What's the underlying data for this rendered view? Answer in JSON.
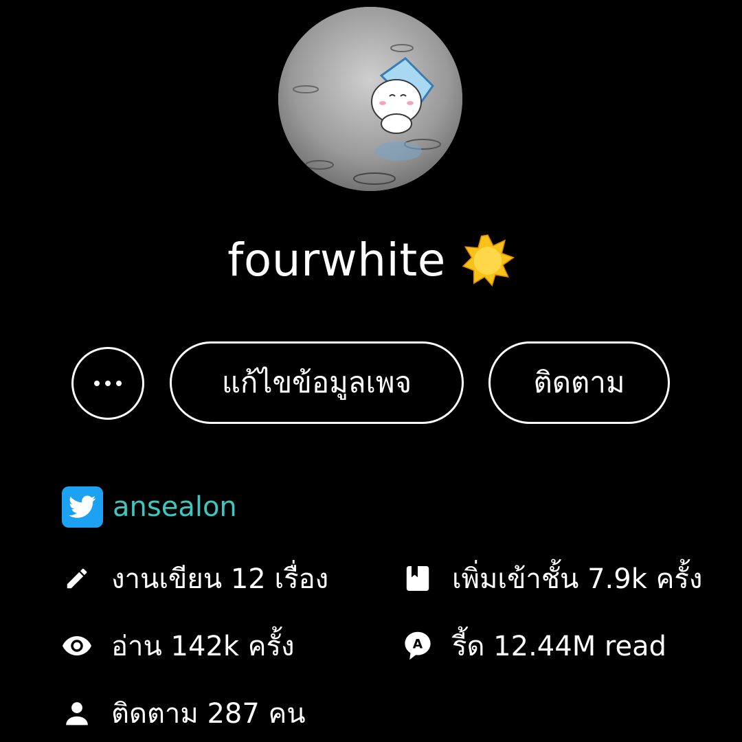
{
  "profile": {
    "username": "fourwhite",
    "badge_icon": "star-badge-icon",
    "avatar_icon": "cat-avatar-image"
  },
  "actions": {
    "more_icon": "more-dots-icon",
    "edit_label": "แก้ไขข้อมูลเพจ",
    "follow_label": "ติดตาม"
  },
  "twitter": {
    "icon": "twitter-icon",
    "handle": "ansealon",
    "color": "#1da1f2",
    "handle_color": "#3ec6c0"
  },
  "stats": {
    "works": {
      "icon": "pencil-icon",
      "text": "งานเขียน 12 เรื่อง"
    },
    "shelf": {
      "icon": "bookmark-icon",
      "text": "เพิ่มเข้าชั้น 7.9k ครั้ง"
    },
    "reads": {
      "icon": "eye-icon",
      "text": "อ่าน 142k ครั้ง"
    },
    "reader": {
      "icon": "reader-bubble-icon",
      "text": "รี้ด 12.44M read"
    },
    "followers": {
      "icon": "person-icon",
      "text": "ติดตาม 287 คน"
    }
  },
  "colors": {
    "background": "#000000",
    "text": "#ffffff",
    "badge": "#f7c31b"
  }
}
